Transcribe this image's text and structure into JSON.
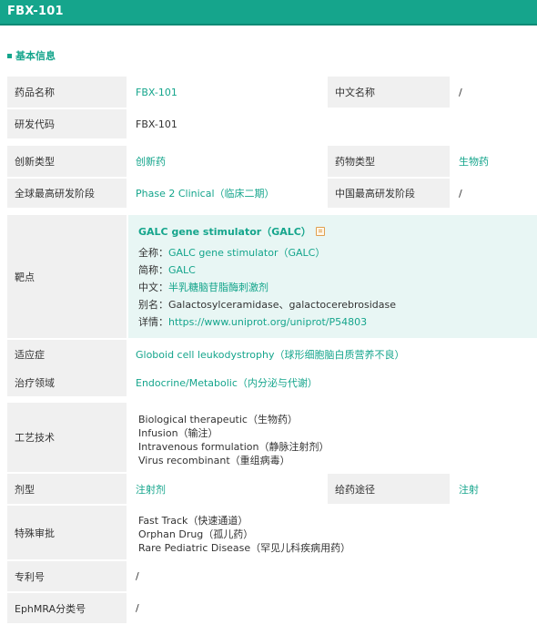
{
  "header": {
    "title": "FBX-101"
  },
  "section": {
    "title": "基本信息"
  },
  "rows": {
    "drug_name_label": "药品名称",
    "drug_name": "FBX-101",
    "cn_name_label": "中文名称",
    "cn_name": "/",
    "code_label": "研发代码",
    "code": "FBX-101",
    "innov_label": "创新类型",
    "innov": "创新药",
    "drug_type_label": "药物类型",
    "drug_type": "生物药",
    "global_phase_label": "全球最高研发阶段",
    "global_phase": "Phase 2 Clinical（临床二期）",
    "cn_phase_label": "中国最高研发阶段",
    "cn_phase": "/",
    "target_label": "靶点",
    "indication_label": "适应症",
    "indication": "Globoid cell leukodystrophy（球形细胞脑白质营养不良）",
    "area_label": "治疗领域",
    "area": "Endocrine/Metabolic（内分泌与代谢）",
    "tech_label": "工艺技术",
    "form_label": "剂型",
    "form": "注射剂",
    "route_label": "给药途径",
    "route": "注射",
    "approval_label": "特殊审批",
    "patent_label": "专利号",
    "patent": "/",
    "ephmra_label": "EphMRA分类号",
    "ephmra": "/"
  },
  "target": {
    "name": "GALC gene stimulator（GALC）",
    "full_label": "全称：",
    "full": "GALC gene stimulator（GALC）",
    "abbr_label": "简称：",
    "abbr": "GALC",
    "cn_label": "中文：",
    "cn": "半乳糖脑苷脂酶刺激剂",
    "alias_label": "别名：",
    "alias": "Galactosylceramidase、galactocerebrosidase",
    "detail_label": "详情：",
    "detail": "https://www.uniprot.org/uniprot/P54803"
  },
  "tech": [
    "Biological therapeutic（生物药）",
    "Infusion（输注）",
    "Intravenous formulation（静脉注射剂）",
    "Virus recombinant（重组病毒）"
  ],
  "approval": [
    "Fast Track（快速通道）",
    "Orphan Drug（孤儿药）",
    "Rare Pediatric Disease（罕见儿科疾病用药）"
  ],
  "colors": {
    "accent": "#15a58c",
    "label_bg": "#f0f0f0",
    "target_bg": "#e8f6f4"
  }
}
